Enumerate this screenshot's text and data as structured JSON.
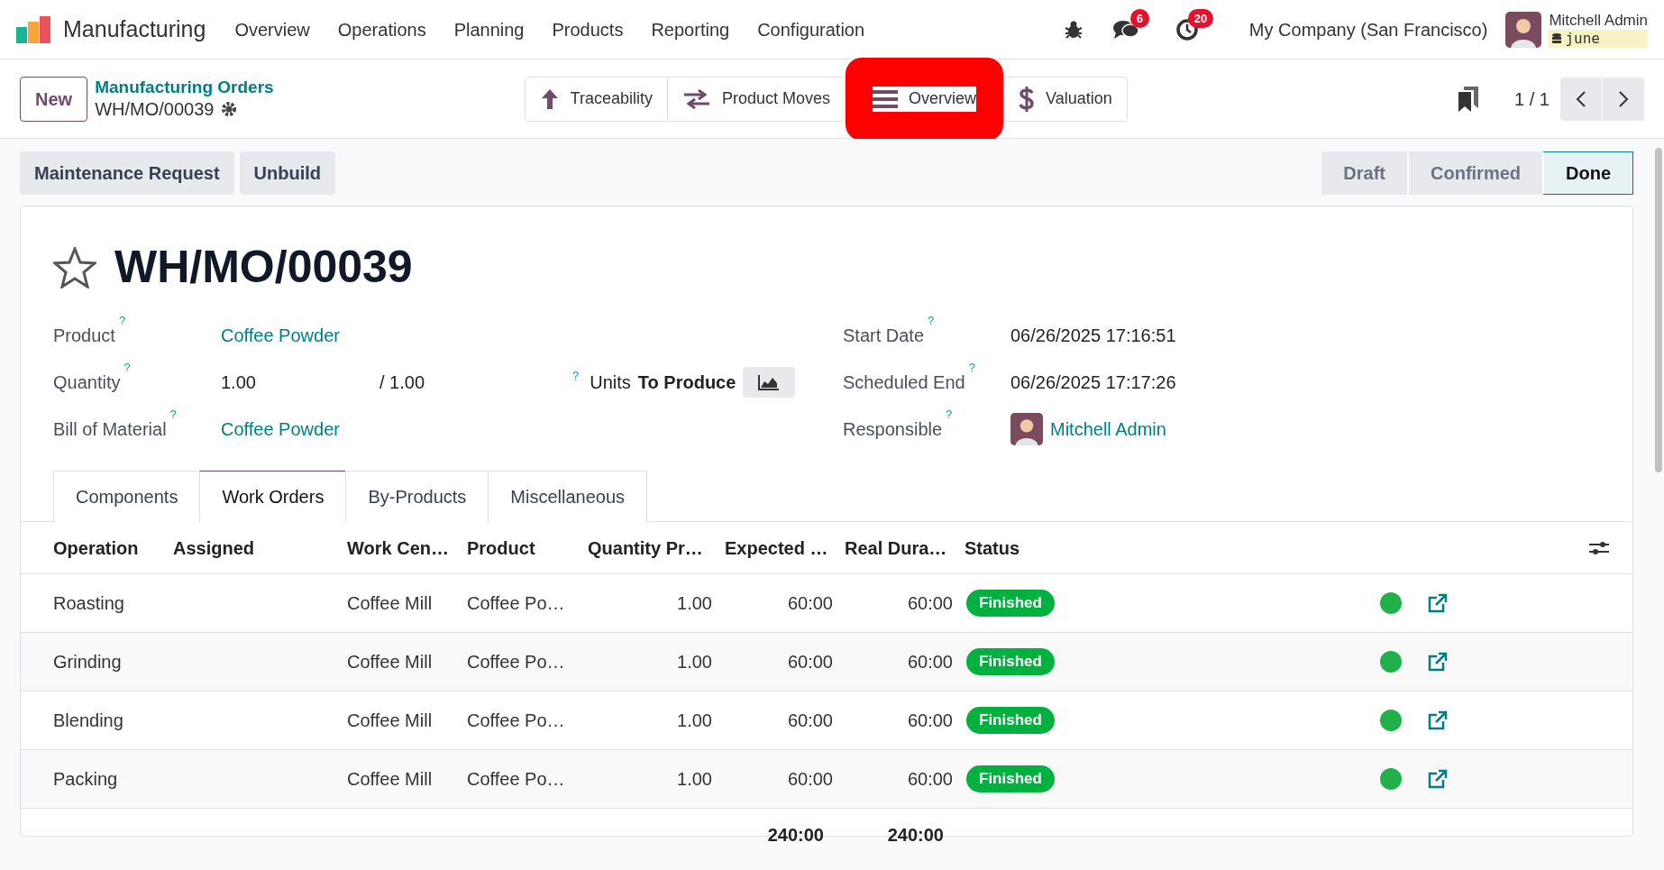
{
  "app": {
    "name": "Manufacturing"
  },
  "menu": [
    "Overview",
    "Operations",
    "Planning",
    "Products",
    "Reporting",
    "Configuration"
  ],
  "systray": {
    "messages_count": "6",
    "activities_count": "20",
    "company": "My Company (San Francisco)",
    "user": "Mitchell Admin",
    "database": "june"
  },
  "breadcrumb": {
    "new_button": "New",
    "parent": "Manufacturing Orders",
    "current": "WH/MO/00039"
  },
  "smart_buttons": [
    {
      "kind": "traceability",
      "label": "Traceability",
      "highlighted": false
    },
    {
      "kind": "moves",
      "label": "Product Moves",
      "highlighted": false
    },
    {
      "kind": "overview",
      "label": "Overview",
      "highlighted": true
    },
    {
      "kind": "valuation",
      "label": "Valuation",
      "highlighted": false
    }
  ],
  "pager": "1 / 1",
  "actions": [
    "Maintenance Request",
    "Unbuild"
  ],
  "stages": [
    {
      "label": "Draft",
      "selected": false
    },
    {
      "label": "Confirmed",
      "selected": false
    },
    {
      "label": "Done",
      "selected": true
    }
  ],
  "record": {
    "title": "WH/MO/00039",
    "starred": false
  },
  "product": {
    "label": "Product",
    "help": "?",
    "value": "Coffee Powder"
  },
  "quantity": {
    "label": "Quantity",
    "help": "?",
    "value": "1.00",
    "target": "/ 1.00",
    "uom_help": "?",
    "uom": "Units",
    "suffix": "To Produce"
  },
  "bom": {
    "label": "Bill of Material",
    "help": "?",
    "value": "Coffee Powder"
  },
  "start_date": {
    "label": "Start Date",
    "help": "?",
    "value": "06/26/2025 17:16:51"
  },
  "scheduled_end": {
    "label": "Scheduled End",
    "help": "?",
    "value": "06/26/2025 17:17:26"
  },
  "responsible": {
    "label": "Responsible",
    "help": "?",
    "value": "Mitchell Admin"
  },
  "tabs": [
    {
      "label": "Components",
      "selected": false
    },
    {
      "label": "Work Orders",
      "selected": true
    },
    {
      "label": "By-Products",
      "selected": false
    },
    {
      "label": "Miscellaneous",
      "selected": false
    }
  ],
  "table": {
    "columns": [
      "Operation",
      "Assigned",
      "Work Cen…",
      "Product",
      "Quantity Pr…",
      "Expected …",
      "Real Dura…",
      "Status"
    ],
    "rows": [
      {
        "operation": "Roasting",
        "work_center": "Coffee Mill",
        "product": "Coffee Po…",
        "quantity": "1.00",
        "expected": "60:00",
        "real": "60:00",
        "status": "Finished"
      },
      {
        "operation": "Grinding",
        "work_center": "Coffee Mill",
        "product": "Coffee Po…",
        "quantity": "1.00",
        "expected": "60:00",
        "real": "60:00",
        "status": "Finished"
      },
      {
        "operation": "Blending",
        "work_center": "Coffee Mill",
        "product": "Coffee Po…",
        "quantity": "1.00",
        "expected": "60:00",
        "real": "60:00",
        "status": "Finished"
      },
      {
        "operation": "Packing",
        "work_center": "Coffee Mill",
        "product": "Coffee Po…",
        "quantity": "1.00",
        "expected": "60:00",
        "real": "60:00",
        "status": "Finished"
      }
    ],
    "totals": {
      "expected": "240:00",
      "real": "240:00"
    }
  }
}
